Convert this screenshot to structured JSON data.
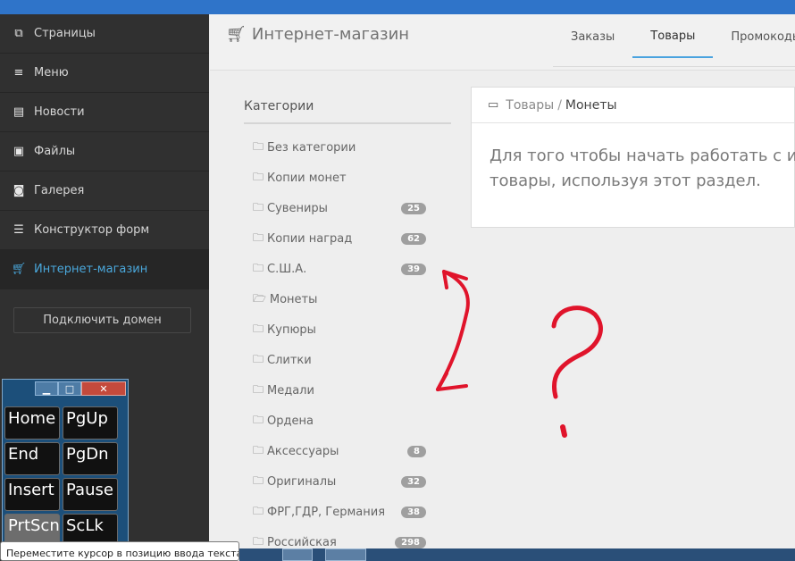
{
  "sidebar": {
    "items": [
      {
        "label": "Страницы",
        "icon": "pages-icon"
      },
      {
        "label": "Меню",
        "icon": "menu-icon"
      },
      {
        "label": "Новости",
        "icon": "news-icon"
      },
      {
        "label": "Файлы",
        "icon": "files-icon"
      },
      {
        "label": "Галерея",
        "icon": "camera-icon"
      },
      {
        "label": "Конструктор форм",
        "icon": "form-icon"
      },
      {
        "label": "Интернет-магазин",
        "icon": "cart-icon"
      }
    ],
    "connect_domain": "Подключить домен"
  },
  "header": {
    "title": "Интернет-магазин",
    "tabs": [
      "Заказы",
      "Товары",
      "Промокоды"
    ]
  },
  "categories": {
    "title": "Категории",
    "items": [
      {
        "label": "Без категории",
        "count": null
      },
      {
        "label": "Копии монет",
        "count": null
      },
      {
        "label": "Сувениры",
        "count": "25"
      },
      {
        "label": "Копии наград",
        "count": "62"
      },
      {
        "label": "С.Ш.А.",
        "count": "39"
      },
      {
        "label": "Монеты",
        "count": null
      },
      {
        "label": "Купюры",
        "count": null
      },
      {
        "label": "Слитки",
        "count": null
      },
      {
        "label": "Медали",
        "count": null
      },
      {
        "label": "Ордена",
        "count": null
      },
      {
        "label": "Аксессуары",
        "count": "8"
      },
      {
        "label": "Оригиналы",
        "count": "32"
      },
      {
        "label": "ФРГ,ГДР, Германия",
        "count": "38"
      },
      {
        "label": "Российская",
        "count": "298"
      }
    ]
  },
  "panel": {
    "crumb_link": "Товары",
    "crumb_sep": "/",
    "crumb_current": "Монеты",
    "line1": "Для того чтобы начать работать с инт",
    "line2": "товары, используя этот раздел."
  },
  "osk": {
    "keys": [
      "Home",
      "PgUp",
      "End",
      "PgDn",
      "Insert",
      "Pause",
      "PrtScn",
      "ScLk"
    ]
  },
  "tooltip": "Переместите курсор в позицию ввода текста.",
  "colors": {
    "accent": "#4aa8dc",
    "annotation": "#e0142b"
  }
}
